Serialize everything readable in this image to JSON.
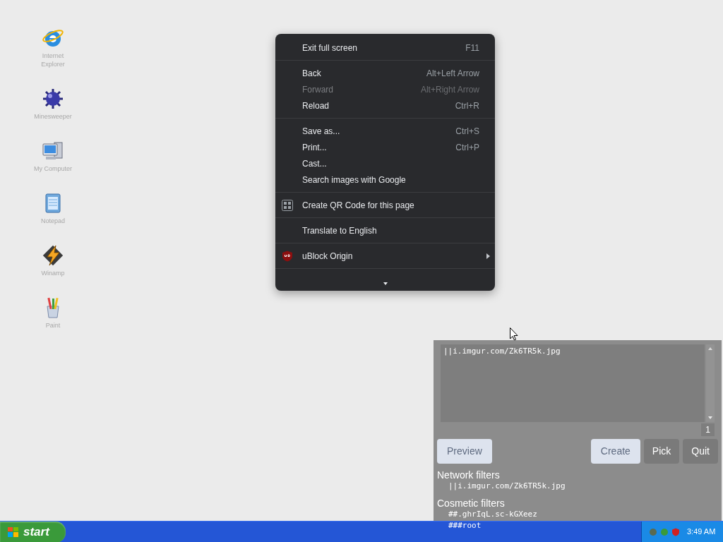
{
  "desktop_icons": [
    {
      "label": "Internet Explorer",
      "kind": "browser"
    },
    {
      "label": "Minesweeper",
      "kind": "mine"
    },
    {
      "label": "My Computer",
      "kind": "computer"
    },
    {
      "label": "Notepad",
      "kind": "notepad"
    },
    {
      "label": "Winamp",
      "kind": "media"
    },
    {
      "label": "Paint",
      "kind": "paint"
    }
  ],
  "context_menu": {
    "sections": [
      [
        {
          "label": "Exit full screen",
          "shortcut": "F11",
          "disabled": false,
          "submenu": false,
          "kind": "plain"
        }
      ],
      [
        {
          "label": "Back",
          "shortcut": "Alt+Left Arrow",
          "disabled": false,
          "submenu": false,
          "kind": "plain"
        },
        {
          "label": "Forward",
          "shortcut": "Alt+Right Arrow",
          "disabled": true,
          "submenu": false,
          "kind": "plain"
        },
        {
          "label": "Reload",
          "shortcut": "Ctrl+R",
          "disabled": false,
          "submenu": false,
          "kind": "plain"
        }
      ],
      [
        {
          "label": "Save as...",
          "shortcut": "Ctrl+S",
          "disabled": false,
          "submenu": false,
          "kind": "plain"
        },
        {
          "label": "Print...",
          "shortcut": "Ctrl+P",
          "disabled": false,
          "submenu": false,
          "kind": "plain"
        },
        {
          "label": "Cast...",
          "disabled": false,
          "submenu": false,
          "kind": "plain"
        },
        {
          "label": "Search images with Google",
          "disabled": false,
          "submenu": false,
          "kind": "plain"
        }
      ],
      [
        {
          "label": "Create QR Code for this page",
          "disabled": false,
          "submenu": false,
          "kind": "qr"
        }
      ],
      [
        {
          "label": "Translate to English",
          "disabled": false,
          "submenu": false,
          "kind": "plain"
        }
      ],
      [
        {
          "label": "uBlock Origin",
          "disabled": false,
          "submenu": true,
          "kind": "extension"
        }
      ]
    ]
  },
  "picker": {
    "filter_text": "||i.imgur.com/Zk6TR5k.jpg",
    "count": "1",
    "buttons": [
      {
        "label": "Preview",
        "kind": "primary"
      },
      {
        "label": "Create",
        "kind": "primary"
      },
      {
        "label": "Pick",
        "kind": "secondary"
      },
      {
        "label": "Quit",
        "kind": "secondary"
      }
    ],
    "network_filters": {
      "title": "Network filters",
      "items": [
        "||i.imgur.com/Zk6TR5k.jpg"
      ]
    },
    "cosmetic_filters": {
      "title": "Cosmetic filters",
      "items": [
        "##.ghrIqL.sc-kGXeez",
        "###root"
      ]
    }
  },
  "taskbar": {
    "start_label": "start",
    "clock": "3:49 AM"
  }
}
